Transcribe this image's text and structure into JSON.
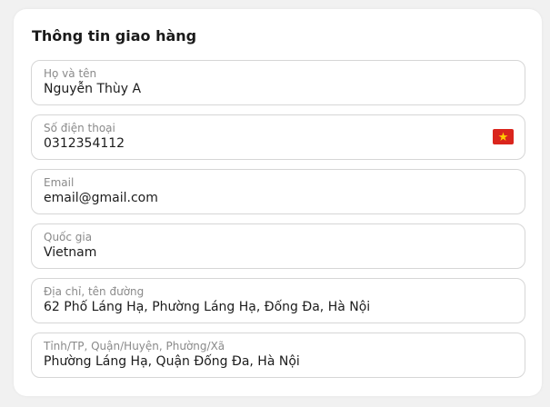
{
  "form": {
    "title": "Thông tin giao hàng",
    "fields": [
      {
        "label": "Họ và tên",
        "value": "Nguyễn Thùy A"
      },
      {
        "label": "Số điện thoại",
        "value": "0312354112",
        "flag_icon": "vietnam-flag-icon"
      },
      {
        "label": "Email",
        "value": "email@gmail.com"
      },
      {
        "label": "Quốc gia",
        "value": "Vietnam"
      },
      {
        "label": "Địa chỉ, tên đường",
        "value": "62 Phố Láng Hạ, Phường Láng Hạ, Đống Đa, Hà Nội"
      },
      {
        "label": "Tỉnh/TP, Quận/Huyện, Phường/Xã",
        "value": "Phường Láng Hạ, Quận Đống Đa, Hà Nội"
      }
    ]
  },
  "colors": {
    "flag_red": "#da251d",
    "flag_star": "#ffcd00"
  }
}
